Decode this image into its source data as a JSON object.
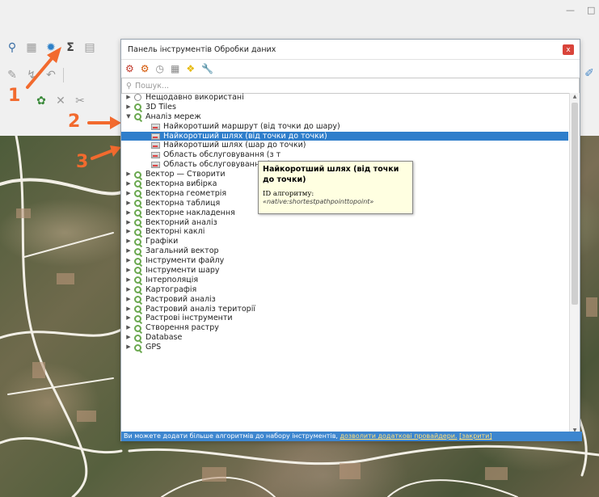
{
  "window": {
    "minimize": "—",
    "maximize": "□"
  },
  "annotations": [
    {
      "label": "1"
    },
    {
      "label": "2"
    },
    {
      "label": "3"
    }
  ],
  "colors": {
    "accent": "#2f7ecb",
    "annotation": "#f26a2e",
    "footer": "#3d86cf",
    "close": "#d9443a",
    "tooltip_bg": "#ffffe1"
  },
  "toolbar": {
    "row1": [
      "identify-icon",
      "table-icon",
      "processing-gear-icon",
      "sigma-icon",
      "attribute-table-icon"
    ],
    "row3": [
      "digitize-icon",
      "node-icon",
      "delete-icon",
      "cut-icon"
    ]
  },
  "dialog": {
    "title": "Панель інструментів Обробки даних",
    "close": "x",
    "search_placeholder": "Пошук...",
    "tree": [
      {
        "label": "Нещодавно використані",
        "type": "clock",
        "level": 0
      },
      {
        "label": "3D Tiles",
        "type": "group",
        "level": 0
      },
      {
        "label": "Аналіз мереж",
        "type": "group",
        "level": 0,
        "expanded": true
      },
      {
        "label": "Найкоротший маршрут (від точки до шару)",
        "type": "alg",
        "level": 1
      },
      {
        "label": "Найкоротший шлях (від точки до точки)",
        "type": "alg",
        "level": 1,
        "selected": true
      },
      {
        "label": "Найкоротший шлях (шар до точки)",
        "type": "alg",
        "level": 1
      },
      {
        "label": "Область обслуговування (з т",
        "type": "alg",
        "level": 1
      },
      {
        "label": "Область обслуговування (з ш",
        "type": "alg",
        "level": 1
      },
      {
        "label": "Вектор — Створити",
        "type": "group",
        "level": 0
      },
      {
        "label": "Векторна вибірка",
        "type": "group",
        "level": 0
      },
      {
        "label": "Векторна геометрія",
        "type": "group",
        "level": 0
      },
      {
        "label": "Векторна таблиця",
        "type": "group",
        "level": 0
      },
      {
        "label": "Векторне накладення",
        "type": "group",
        "level": 0
      },
      {
        "label": "Векторний аналіз",
        "type": "group",
        "level": 0
      },
      {
        "label": "Векторні каклі",
        "type": "group",
        "level": 0
      },
      {
        "label": "Графіки",
        "type": "group",
        "level": 0
      },
      {
        "label": "Загальний вектор",
        "type": "group",
        "level": 0
      },
      {
        "label": "Інструменти файлу",
        "type": "group",
        "level": 0
      },
      {
        "label": "Інструменти шару",
        "type": "group",
        "level": 0
      },
      {
        "label": "Інтерполяція",
        "type": "group",
        "level": 0
      },
      {
        "label": "Картографія",
        "type": "group",
        "level": 0
      },
      {
        "label": "Растровий аналіз",
        "type": "group",
        "level": 0
      },
      {
        "label": "Растровий аналіз території",
        "type": "group",
        "level": 0
      },
      {
        "label": "Растрові інструменти",
        "type": "group",
        "level": 0
      },
      {
        "label": "Створення растру",
        "type": "group",
        "level": 0
      },
      {
        "label": "Database",
        "type": "group",
        "level": 0
      },
      {
        "label": "GPS",
        "type": "group",
        "level": 0
      }
    ],
    "footer": {
      "text": "Ви можете додати більше алгоритмів до набору інструментів,",
      "link1": "дозволити додаткові провайдери.",
      "link2": "[закрити]"
    }
  },
  "tooltip": {
    "title": "Найкоротший шлях (від точки до точки)",
    "id_label": "ID алгоритму:",
    "id_value": "«native:shortestpathpointtopoint»"
  }
}
